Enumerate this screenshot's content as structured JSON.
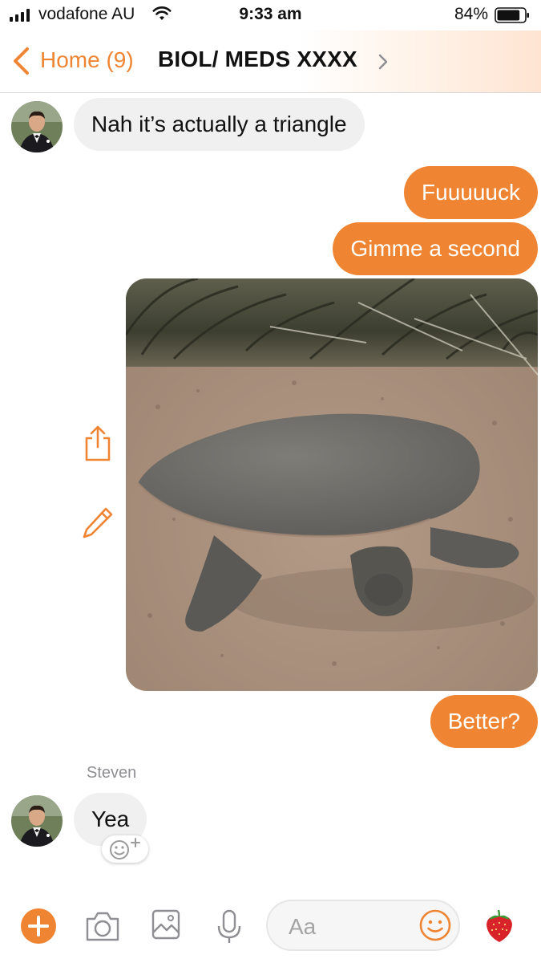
{
  "status_bar": {
    "carrier": "vodafone AU",
    "time": "9:33 am",
    "battery": "84%",
    "battery_level": 0.84
  },
  "nav": {
    "back_label": "Home (9)",
    "title": "BIOL/ MEDS XXXX"
  },
  "messages": [
    {
      "direction": "incoming",
      "text": "Nah it’s actually a triangle"
    },
    {
      "direction": "outgoing",
      "text": "Fuuuuuck"
    },
    {
      "direction": "outgoing",
      "text": "Gimme a second"
    },
    {
      "direction": "outgoing",
      "type": "image",
      "image_subject": "soft-shell turtle on sand"
    },
    {
      "direction": "outgoing",
      "text": "Better?"
    },
    {
      "direction": "incoming",
      "sender": "Steven",
      "text": "Yea"
    }
  ],
  "composer": {
    "placeholder": "Aa"
  },
  "colors": {
    "accent": "#ef8533",
    "incoming_bubble": "#f0f0f0"
  },
  "icons": [
    "back-chevron-icon",
    "title-chevron-icon",
    "share-icon",
    "edit-pencil-icon",
    "add-reaction-icon",
    "plus-icon",
    "camera-icon",
    "gallery-icon",
    "microphone-icon",
    "emoji-icon",
    "strawberry-icon"
  ]
}
